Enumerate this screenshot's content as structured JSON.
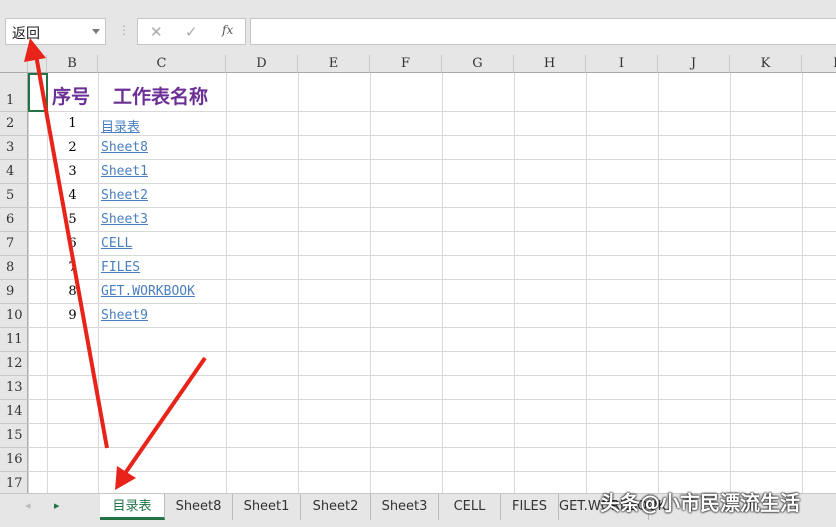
{
  "name_box": "返回",
  "formula_bar": {
    "cancel_icon": "✕",
    "confirm_icon": "✓",
    "fx_label": "fx",
    "value": ""
  },
  "columns": [
    "B",
    "C",
    "D",
    "E",
    "F",
    "G",
    "H",
    "I",
    "J",
    "K",
    "L"
  ],
  "rows": [
    "1",
    "2",
    "3",
    "4",
    "5",
    "6",
    "7",
    "8",
    "9",
    "10",
    "11",
    "12",
    "13",
    "14",
    "15",
    "16",
    "17"
  ],
  "header": {
    "seq": "序号",
    "name": "工作表名称"
  },
  "entries": [
    {
      "n": "1",
      "name": "目录表"
    },
    {
      "n": "2",
      "name": "Sheet8"
    },
    {
      "n": "3",
      "name": "Sheet1"
    },
    {
      "n": "4",
      "name": "Sheet2"
    },
    {
      "n": "5",
      "name": "Sheet3"
    },
    {
      "n": "6",
      "name": "CELL"
    },
    {
      "n": "7",
      "name": "FILES"
    },
    {
      "n": "8",
      "name": "GET.WORKBOOK"
    },
    {
      "n": "9",
      "name": "Sheet9"
    }
  ],
  "tabs": [
    "目录表",
    "Sheet8",
    "Sheet1",
    "Sheet2",
    "Sheet3",
    "CELL",
    "FILES",
    "GET.WORKBOOK"
  ],
  "watermark": "头条@小市民漂流生活",
  "colors": {
    "header": "#6b2f96",
    "link": "#4a7fbf",
    "accent": "#217346",
    "arrow": "#e8231a"
  }
}
